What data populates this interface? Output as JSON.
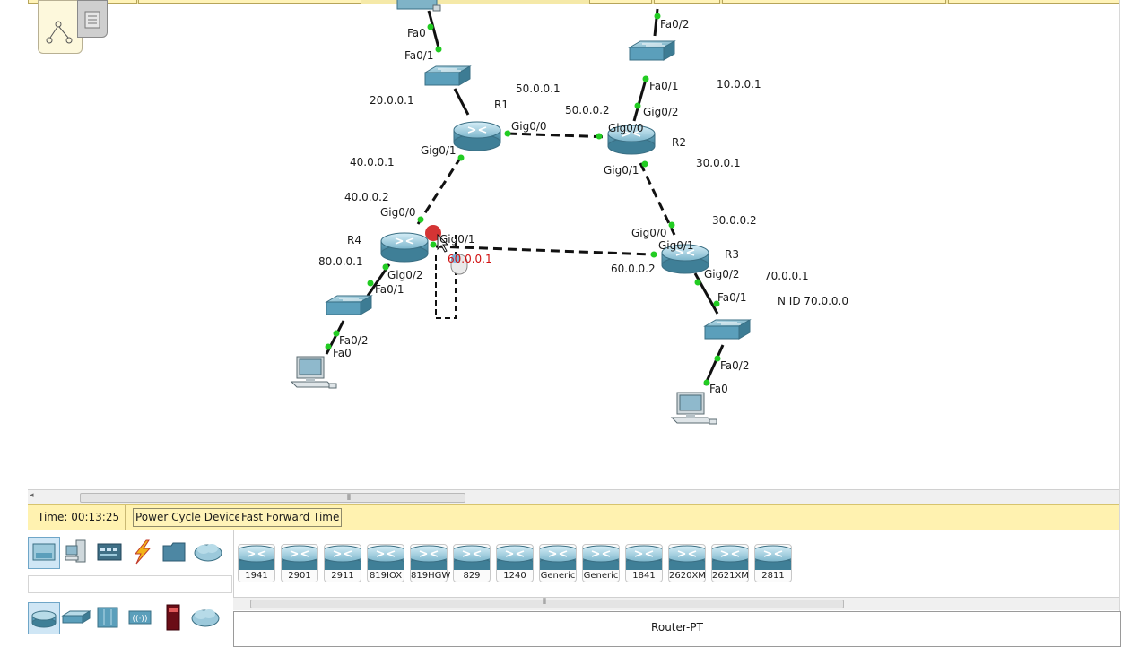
{
  "status_bar": {
    "time_label": "Time: 00:13:25",
    "power_cycle_label": "Power Cycle Devices",
    "fast_forward_label": "Fast Forward Time"
  },
  "topology": {
    "devices": {
      "r1": "R1",
      "r2": "R2",
      "r3": "R3",
      "r4": "R4"
    },
    "ports": {
      "top_pc_fa0": "Fa0",
      "top_sw_fa01": "Fa0/1",
      "r1_gig00": "Gig0/0",
      "r1_gig01": "Gig0/1",
      "r2_gig00": "Gig0/0",
      "r2_gig01": "Gig0/1",
      "r2_gig02": "Gig0/2",
      "top_right_sw_fa02": "Fa0/2",
      "top_right_sw_fa01": "Fa0/1",
      "r4_gig00": "Gig0/0",
      "r4_gig01": "Gig0/1",
      "r4_gig02": "Gig0/2",
      "left_sw_fa01": "Fa0/1",
      "left_sw_fa02": "Fa0/2",
      "left_pc_fa0": "Fa0",
      "r3_gig00": "Gig0/0",
      "r3_gig01": "Gig0/1",
      "r3_gig02": "Gig0/2",
      "right_sw_fa01": "Fa0/1",
      "right_sw_fa02": "Fa0/2",
      "right_pc_fa0": "Fa0"
    },
    "addresses": {
      "net_20": "20.0.0.1",
      "net_50_1": "50.0.0.1",
      "net_50_2": "50.0.0.2",
      "net_10": "10.0.0.1",
      "net_40_1": "40.0.0.1",
      "net_40_2": "40.0.0.2",
      "net_30_1": "30.0.0.1",
      "net_30_2": "30.0.0.2",
      "net_80": "80.0.0.1",
      "net_60_1": "60.0.0.1",
      "net_60_2": "60.0.0.2",
      "net_70": "70.0.0.1",
      "nid_70": "N ID  70.0.0.0"
    }
  },
  "device_list": [
    {
      "name": "1941"
    },
    {
      "name": "2901"
    },
    {
      "name": "2911"
    },
    {
      "name": "819IOX"
    },
    {
      "name": "819HGW"
    },
    {
      "name": "829"
    },
    {
      "name": "1240"
    },
    {
      "name": "Generic"
    },
    {
      "name": "Generic"
    },
    {
      "name": "1841"
    },
    {
      "name": "2620XM"
    },
    {
      "name": "2621XM"
    },
    {
      "name": "2811"
    }
  ],
  "device_info": {
    "selected": "Router-PT"
  },
  "colors": {
    "status_bar_bg": "#fff2b0",
    "link_up": "#22cc22",
    "link_down": "#cc1111",
    "device_blue": "#5b9fbb"
  }
}
